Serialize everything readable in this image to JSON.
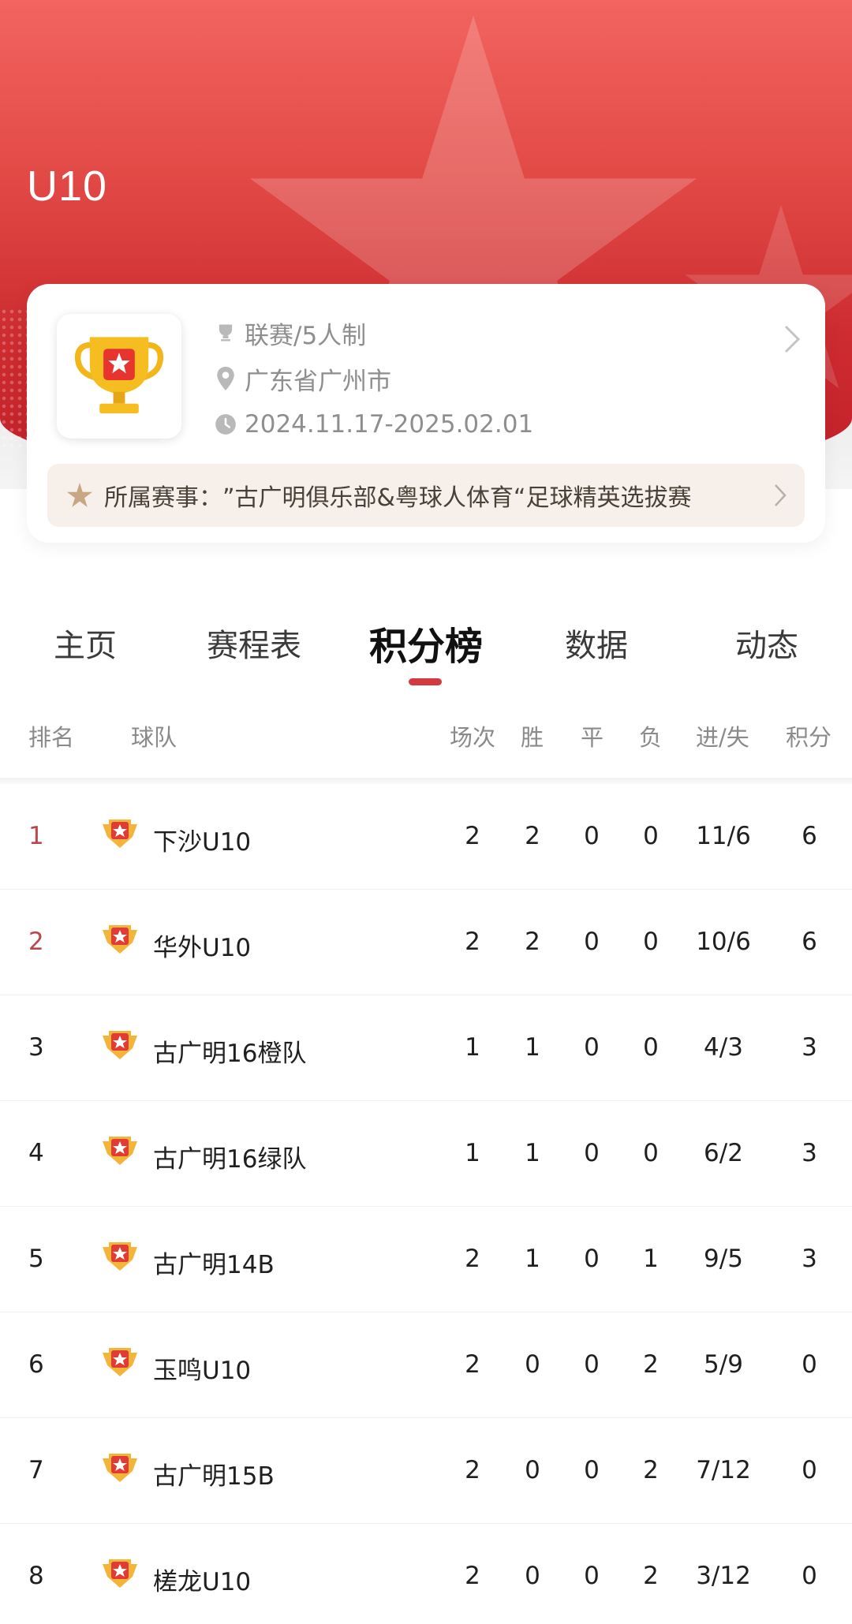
{
  "page": {
    "title": "U10"
  },
  "info_card": {
    "format": "联赛/5人制",
    "location": "广东省广州市",
    "date_range": "2024.11.17-2025.02.01",
    "parent_event_label": "所属赛事：",
    "parent_event_name": "”古广明俱乐部&粤球人体育“足球精英选拔赛"
  },
  "tabs": [
    {
      "label": "主页",
      "active": false
    },
    {
      "label": "赛程表",
      "active": false
    },
    {
      "label": "积分榜",
      "active": true
    },
    {
      "label": "数据",
      "active": false
    },
    {
      "label": "动态",
      "active": false
    }
  ],
  "table": {
    "headers": {
      "rank": "排名",
      "team": "球队",
      "played": "场次",
      "won": "胜",
      "draw": "平",
      "lost": "负",
      "goals": "进/失",
      "points": "积分"
    },
    "rows": [
      {
        "rank": "1",
        "team": "下沙U10",
        "played": "2",
        "won": "2",
        "draw": "0",
        "lost": "0",
        "goals": "11/6",
        "points": "6"
      },
      {
        "rank": "2",
        "team": "华外U10",
        "played": "2",
        "won": "2",
        "draw": "0",
        "lost": "0",
        "goals": "10/6",
        "points": "6"
      },
      {
        "rank": "3",
        "team": "古广明16橙队",
        "played": "1",
        "won": "1",
        "draw": "0",
        "lost": "0",
        "goals": "4/3",
        "points": "3"
      },
      {
        "rank": "4",
        "team": "古广明16绿队",
        "played": "1",
        "won": "1",
        "draw": "0",
        "lost": "0",
        "goals": "6/2",
        "points": "3"
      },
      {
        "rank": "5",
        "team": "古广明14B",
        "played": "2",
        "won": "1",
        "draw": "0",
        "lost": "1",
        "goals": "9/5",
        "points": "3"
      },
      {
        "rank": "6",
        "team": "玉鸣U10",
        "played": "2",
        "won": "0",
        "draw": "0",
        "lost": "2",
        "goals": "5/9",
        "points": "0"
      },
      {
        "rank": "7",
        "team": "古广明15B",
        "played": "2",
        "won": "0",
        "draw": "0",
        "lost": "2",
        "goals": "7/12",
        "points": "0"
      },
      {
        "rank": "8",
        "team": "槎龙U10",
        "played": "2",
        "won": "0",
        "draw": "0",
        "lost": "2",
        "goals": "3/12",
        "points": "0"
      }
    ]
  },
  "colors": {
    "accent": "#d23a3f",
    "hero_top": "#f26460",
    "hero_bottom": "#c1202a",
    "rank_top": "#b8484c",
    "trophy_gold": "#f2b61a"
  }
}
